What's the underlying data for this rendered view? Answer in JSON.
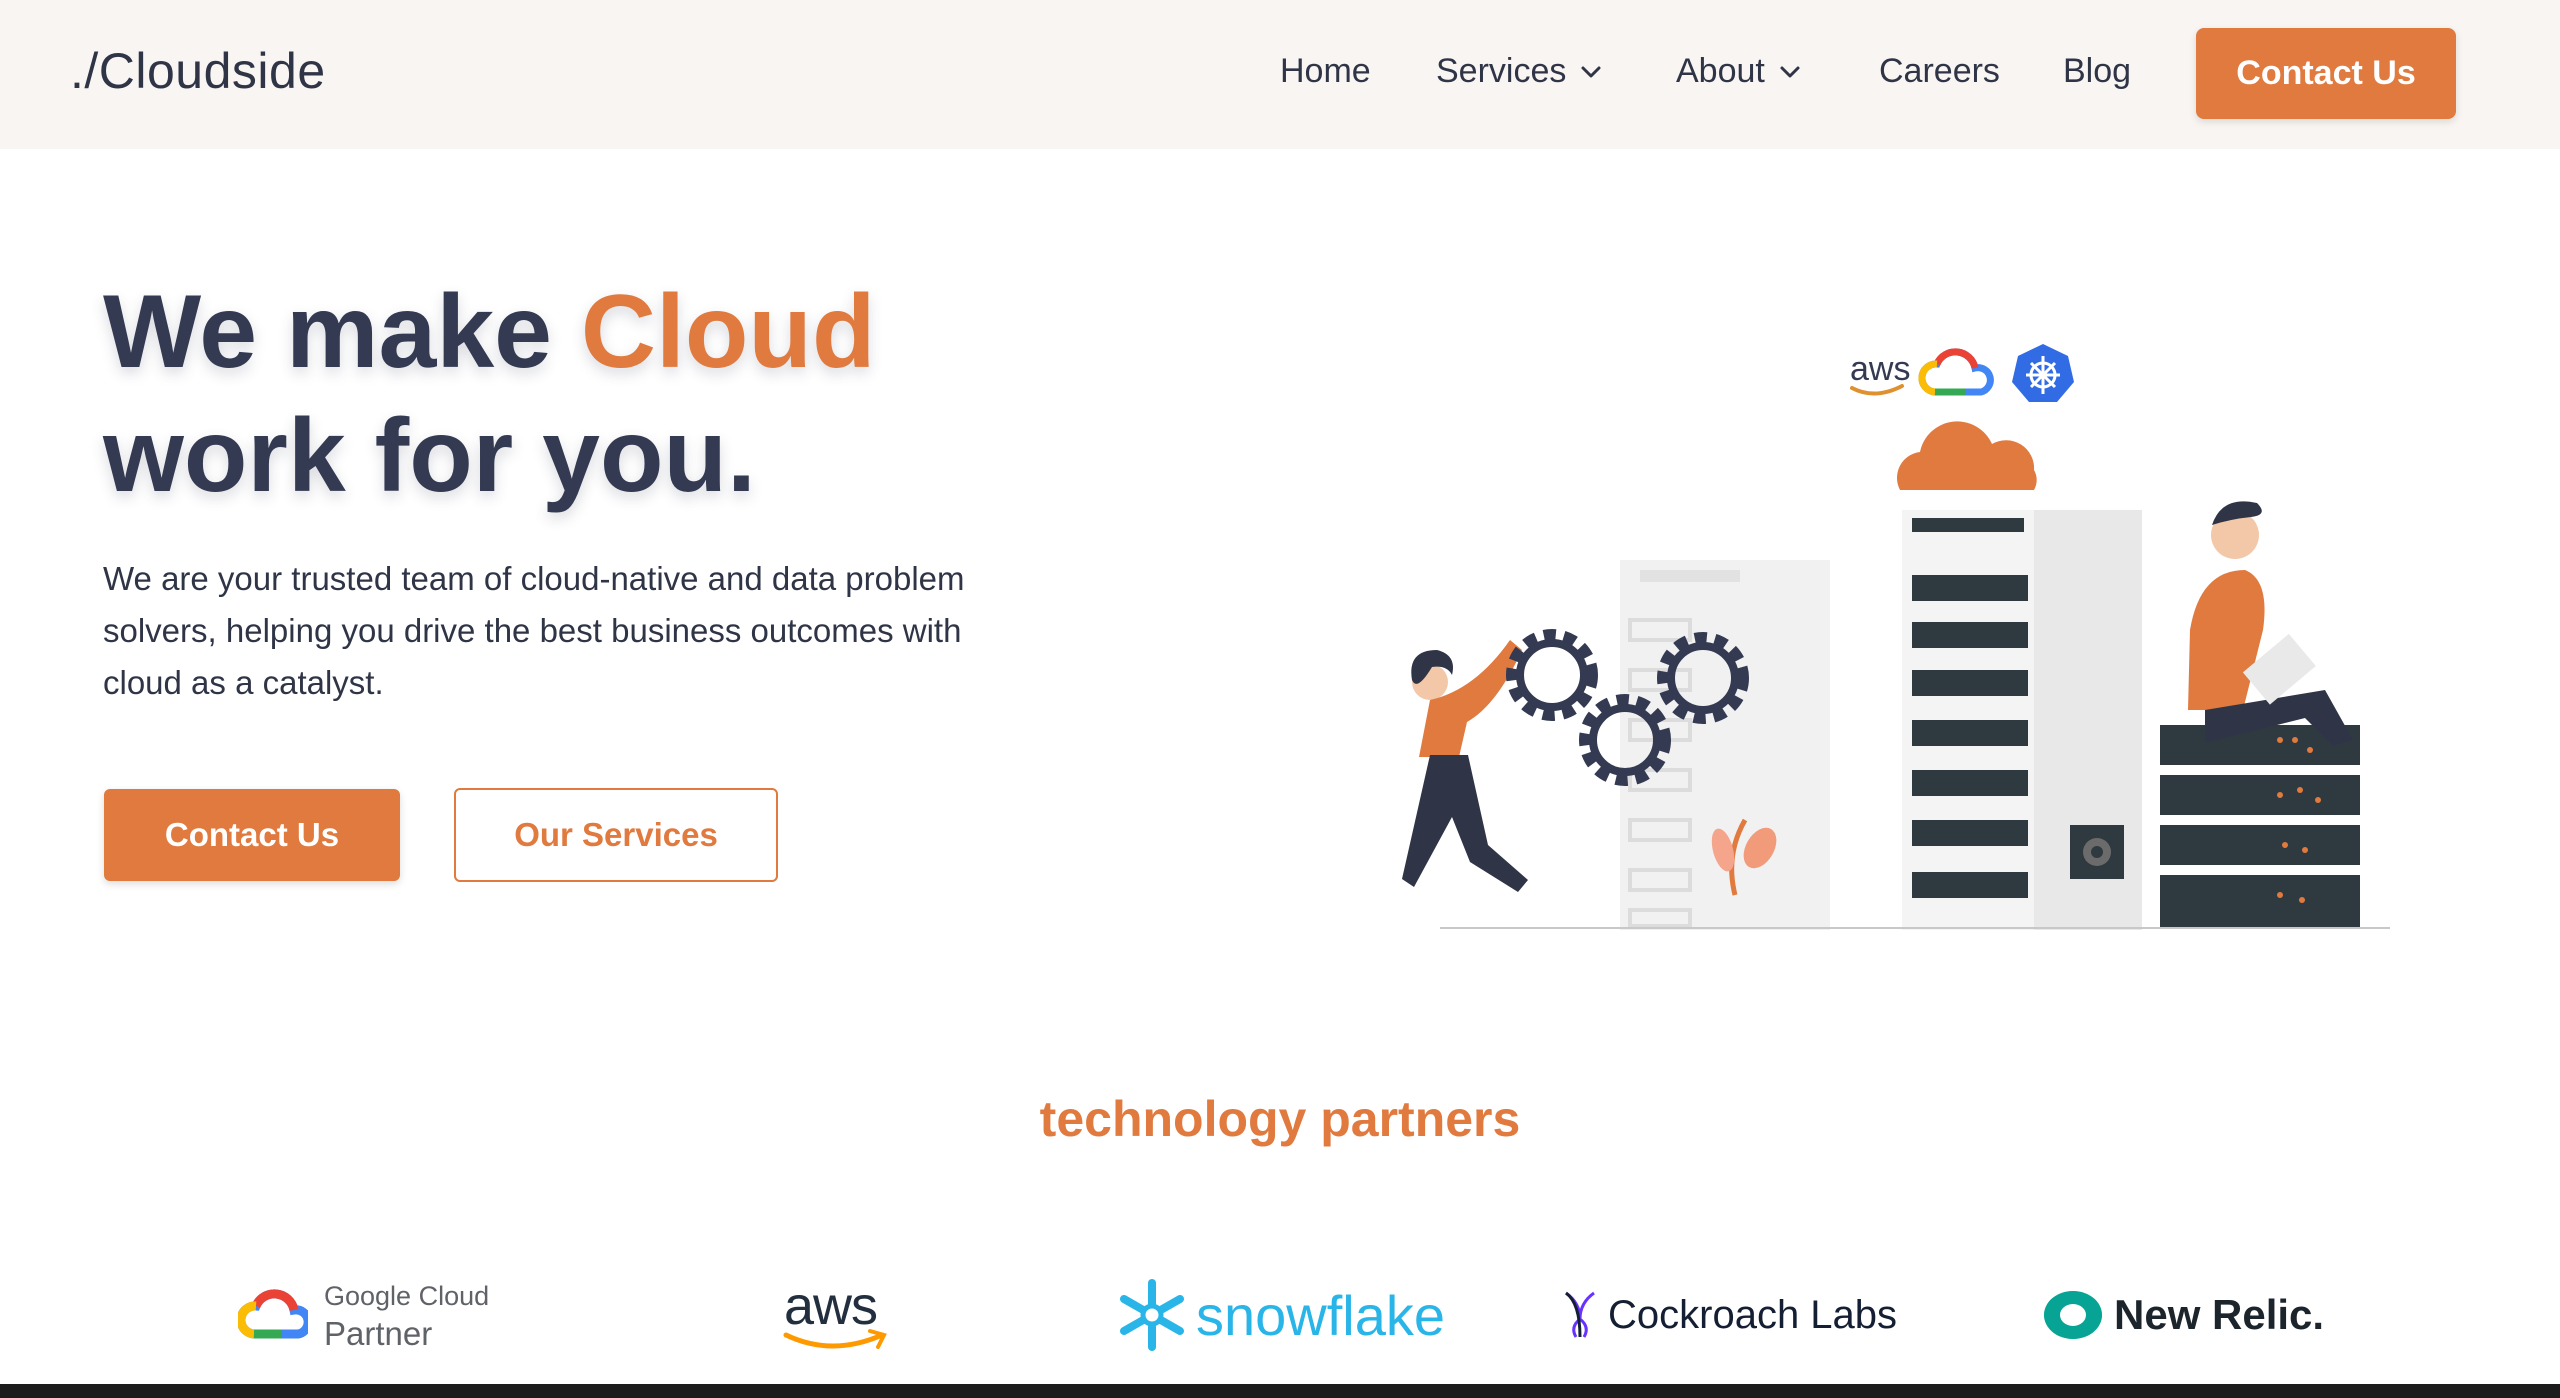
{
  "brand": {
    "logo_text": "./Cloudside"
  },
  "nav": {
    "items": [
      {
        "label": "Home",
        "has_dropdown": false
      },
      {
        "label": "Services",
        "has_dropdown": true
      },
      {
        "label": "About",
        "has_dropdown": true
      },
      {
        "label": "Careers",
        "has_dropdown": false
      },
      {
        "label": "Blog",
        "has_dropdown": false
      }
    ],
    "cta_label": "Contact Us"
  },
  "hero": {
    "title_part1": "We make ",
    "title_accent": "Cloud",
    "title_part2": "work for you.",
    "description": "We are your trusted team of cloud-native and data problem solvers, helping you drive the best business outcomes with cloud as a catalyst.",
    "primary_button": "Contact Us",
    "secondary_button": "Our Services",
    "illustration_badges": [
      "aws"
    ]
  },
  "partners": {
    "title": "technology partners",
    "items": [
      {
        "name": "Google Cloud",
        "subtitle": "Partner"
      },
      {
        "name": "aws"
      },
      {
        "name": "snowflake"
      },
      {
        "name": "Cockroach Labs"
      },
      {
        "name": "New Relic."
      }
    ]
  },
  "colors": {
    "accent": "#e07a3f",
    "text": "#333a52",
    "nav_bg": "#f9f5f2"
  }
}
